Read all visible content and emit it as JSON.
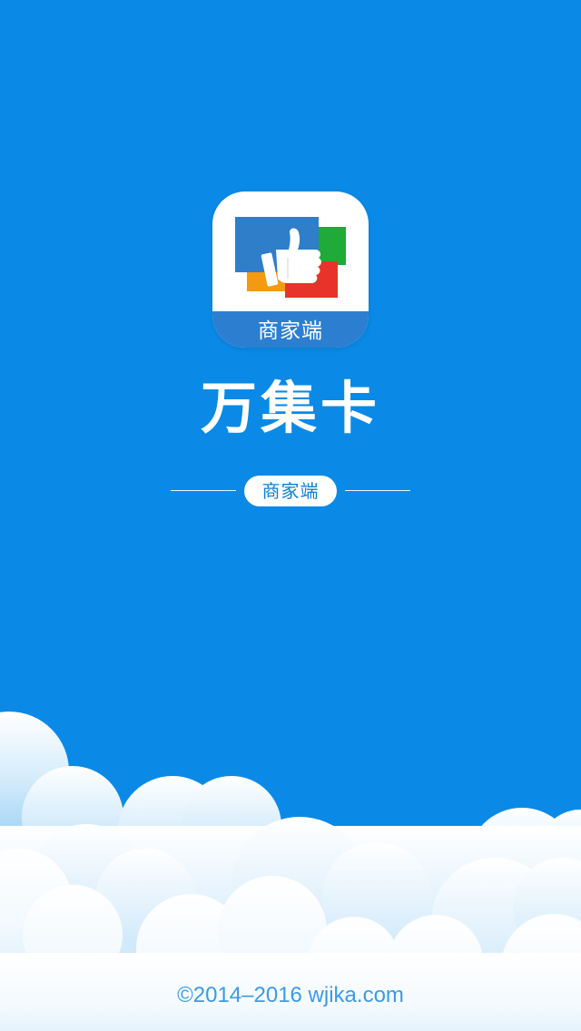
{
  "app": {
    "icon_label": "商家端",
    "title": "万集卡",
    "subtitle_badge": "商家端"
  },
  "footer": {
    "copyright": "©2014–2016 wjika.com"
  },
  "colors": {
    "background": "#0a8ae6",
    "icon_band": "#2c7fd0",
    "card_blue": "#2e7ec9",
    "card_green": "#1faa3a",
    "card_orange": "#f39a12",
    "card_red": "#e8332a",
    "footer_text": "#3a9be6"
  },
  "icons": {
    "app_logo": "thumbs-up-cards-icon"
  }
}
